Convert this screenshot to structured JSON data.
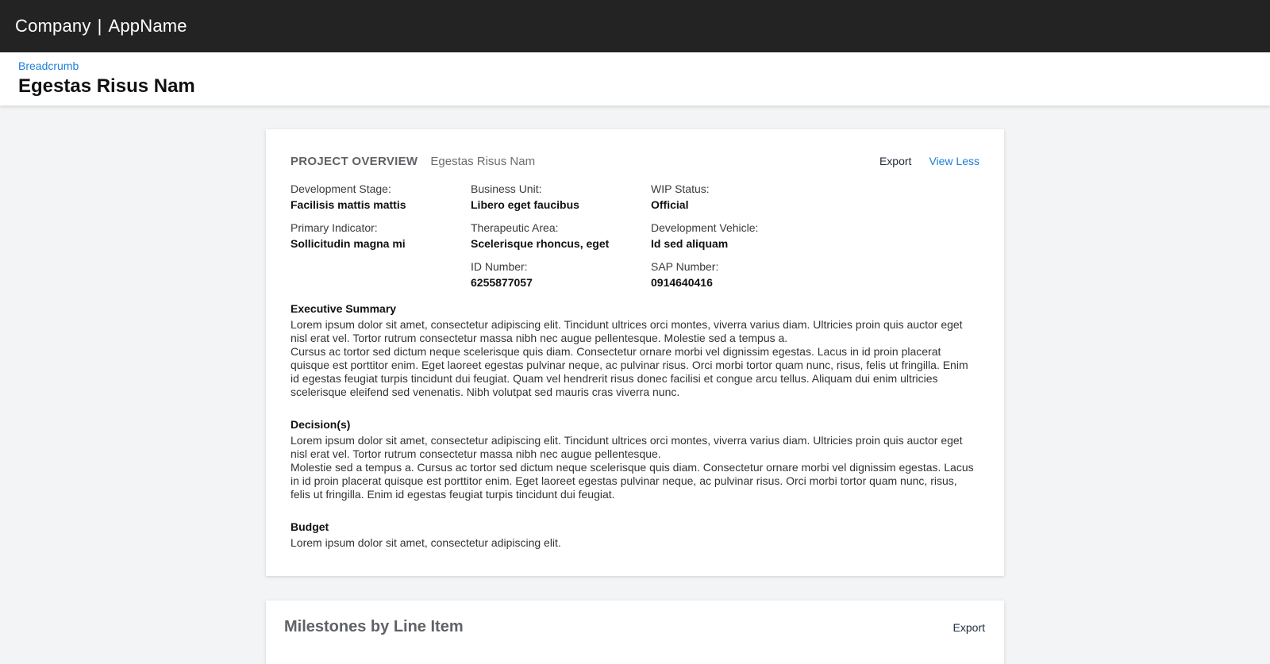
{
  "topbar": {
    "company": "Company",
    "separator": "|",
    "app_name": "AppName"
  },
  "header": {
    "breadcrumb": "Breadcrumb",
    "title": "Egestas Risus Nam"
  },
  "overview": {
    "section_title": "PROJECT OVERVIEW",
    "subtitle": "Egestas Risus Nam",
    "export_label": "Export",
    "view_less_label": "View Less",
    "fields": {
      "development_stage": {
        "label": "Development Stage:",
        "value": "Facilisis mattis mattis"
      },
      "business_unit": {
        "label": "Business Unit:",
        "value": "Libero eget faucibus"
      },
      "wip_status": {
        "label": "WIP Status:",
        "value": "Official"
      },
      "primary_indicator": {
        "label": "Primary Indicator:",
        "value": "Sollicitudin magna mi"
      },
      "therapeutic_area": {
        "label": "Therapeutic Area:",
        "value": "Scelerisque rhoncus, eget"
      },
      "development_vehicle": {
        "label": "Development Vehicle:",
        "value": "Id sed aliquam"
      },
      "id_number": {
        "label": "ID Number:",
        "value": "6255877057"
      },
      "sap_number": {
        "label": "SAP Number:",
        "value": "0914640416"
      }
    },
    "executive_summary": {
      "title": "Executive Summary",
      "p1": "Lorem ipsum dolor sit amet, consectetur adipiscing elit. Tincidunt ultrices orci montes, viverra varius diam. Ultricies proin quis auctor eget nisl erat vel. Tortor rutrum consectetur massa nibh nec augue pellentesque. Molestie sed a tempus a.",
      "p2": "Cursus ac tortor sed dictum neque scelerisque quis diam. Consectetur ornare morbi vel dignissim egestas. Lacus in id proin placerat quisque est porttitor enim. Eget laoreet egestas pulvinar neque, ac pulvinar risus. Orci morbi tortor quam nunc, risus, felis ut fringilla. Enim id egestas feugiat turpis tincidunt dui feugiat. Quam vel hendrerit risus donec facilisi et congue arcu tellus. Aliquam dui enim ultricies scelerisque eleifend sed venenatis. Nibh volutpat sed mauris cras viverra nunc."
    },
    "decisions": {
      "title": "Decision(s)",
      "p1": "Lorem ipsum dolor sit amet, consectetur adipiscing elit. Tincidunt ultrices orci montes, viverra varius diam. Ultricies proin quis auctor eget nisl erat vel. Tortor rutrum consectetur massa nibh nec augue pellentesque.",
      "p2": "Molestie sed a tempus a. Cursus ac tortor sed dictum neque scelerisque quis diam. Consectetur ornare morbi vel dignissim egestas. Lacus in id proin placerat quisque est porttitor enim. Eget laoreet egestas pulvinar neque, ac pulvinar risus. Orci morbi tortor quam nunc, risus, felis ut fringilla. Enim id egestas feugiat turpis tincidunt dui feugiat."
    },
    "budget": {
      "title": "Budget",
      "p1": "Lorem ipsum dolor sit amet, consectetur adipiscing elit."
    }
  },
  "milestones": {
    "title": "Milestones by Line Item",
    "export_label": "Export"
  },
  "colors": {
    "topbar_bg": "#232323",
    "page_bg": "#f3f4f6",
    "link_blue": "#1b7fd6",
    "section_title_gray": "#5f6266"
  }
}
